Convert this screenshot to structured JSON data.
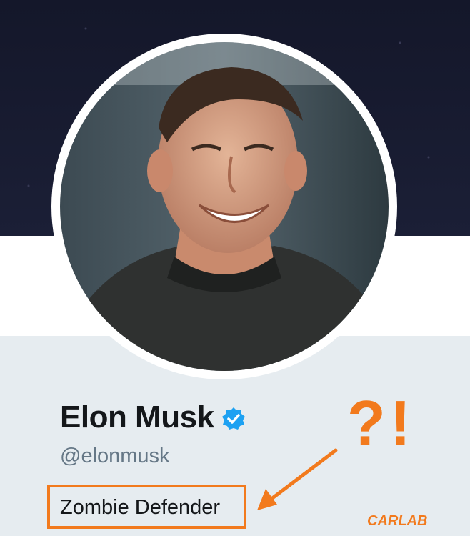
{
  "profile": {
    "name": "Elon Musk",
    "handle": "@elonmusk",
    "bio": "Zombie Defender",
    "verified": true
  },
  "annotation": {
    "text": "?!",
    "color": "#f27a1d"
  },
  "watermark": {
    "text": "CARLAB"
  },
  "colors": {
    "banner": "#171a2e",
    "card_bg": "#e6ecf0",
    "verified_blue": "#1da1f2",
    "name_color": "#14171a",
    "handle_color": "#657786"
  }
}
